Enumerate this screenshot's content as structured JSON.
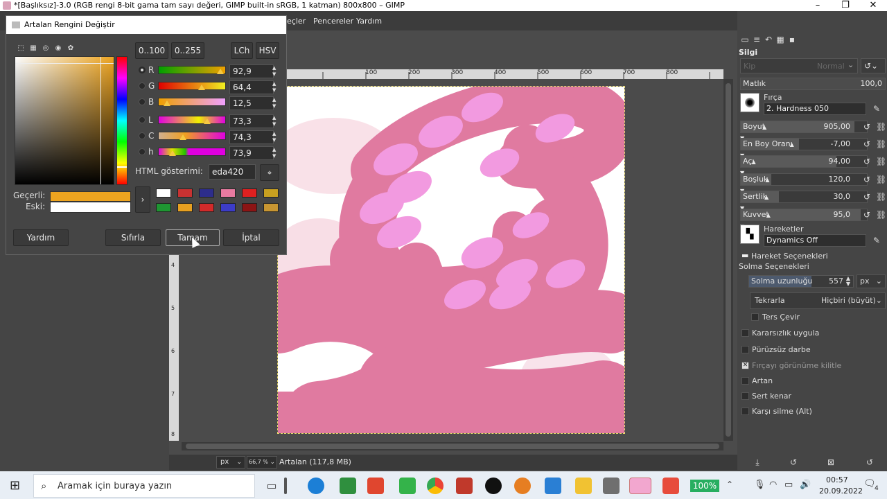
{
  "window": {
    "title": "*[Başlıksız]-3.0 (RGB rengi 8-bit gama tam sayı değeri, GIMP built-in sRGB, 1 katman) 800x800 – GIMP",
    "minimize": "–",
    "maximize": "❐",
    "close": "✕"
  },
  "menu": {
    "items": [
      "eçler",
      "Pencereler",
      "Yardım"
    ]
  },
  "dialog": {
    "title": "Artalan Rengini Değiştir",
    "range_buttons": [
      "0..100",
      "0..255"
    ],
    "model_buttons": [
      "LCh",
      "HSV"
    ],
    "sliders": [
      {
        "label": "R",
        "value": "92,9",
        "fraction": 0.929
      },
      {
        "label": "G",
        "value": "64,4",
        "fraction": 0.644
      },
      {
        "label": "B",
        "value": "12,5",
        "fraction": 0.125
      },
      {
        "label": "L",
        "value": "73,3",
        "fraction": 0.733
      },
      {
        "label": "C",
        "value": "74,3",
        "fraction": 0.36
      },
      {
        "label": "h",
        "value": "73,9",
        "fraction": 0.205
      }
    ],
    "html_label": "HTML gösterimi:",
    "html_value": "eda420",
    "current_label": "Geçerli:",
    "old_label": "Eski:",
    "current_color": "#eda420",
    "old_color": "#ffffff",
    "swatches": [
      "#ffffff",
      "#c83232",
      "#2d2d8c",
      "#e87aa0",
      "#e02020",
      "#c8a020",
      "#1e9632",
      "#e8a020",
      "#d22a2a",
      "#3c3cc8",
      "#8c1414",
      "#c89632"
    ],
    "buttons": {
      "help": "Yardım",
      "reset": "Sıfırla",
      "ok": "Tamam",
      "cancel": "İptal"
    }
  },
  "tool_options": {
    "tool_name": "Silgi",
    "mode_placeholder": "Kip",
    "mode_value": "Normal",
    "opacity_label": "Matlık",
    "opacity_value": "100,0",
    "brush_label": "Fırça",
    "brush_value": "2. Hardness 050",
    "rows": [
      {
        "label": "Boyut",
        "value": "905,00",
        "fraction": 0.9
      },
      {
        "label": "En Boy Oranı",
        "value": "-7,00",
        "fraction": 0.46
      },
      {
        "label": "Açı",
        "value": "94,00",
        "fraction": 0.76
      },
      {
        "label": "Boşluk",
        "value": "120,0",
        "fraction": 0.24
      },
      {
        "label": "Sertlik",
        "value": "30,0",
        "fraction": 0.3
      },
      {
        "label": "Kuvvet",
        "value": "95,0",
        "fraction": 0.95
      }
    ],
    "dynamics_label": "Hareketler",
    "dynamics_value": "Dynamics Off",
    "dynamics_options": "Hareket Seçenekleri",
    "fade_options": "Solma Seçenekleri",
    "fade_length_label": "Solma uzunluğu",
    "fade_length_value": "557",
    "fade_unit": "px",
    "repeat_label": "Tekrarla",
    "repeat_value": "Hiçbiri (büyüt)",
    "reverse": "Ters Çevir",
    "checkboxes": [
      {
        "label": "Kararsızlık uygula",
        "checked": false
      },
      {
        "label": "Pürüzsüz darbe",
        "checked": false
      },
      {
        "label": "Fırçayı görünüme kilitle",
        "checked": true
      },
      {
        "label": "Artan",
        "checked": false
      },
      {
        "label": "Sert kenar",
        "checked": false
      },
      {
        "label": "Karşı silme (Alt)",
        "checked": false
      }
    ]
  },
  "ruler": {
    "h_ticks": [
      "100",
      "200",
      "300",
      "400",
      "500",
      "600",
      "700",
      "800"
    ],
    "v_ticks": [
      "4",
      "5",
      "6",
      "7",
      "8"
    ]
  },
  "status": {
    "unit": "px",
    "zoom": "66,7 %",
    "layer_info": "Artalan (117,8 MB)"
  },
  "taskbar": {
    "search_placeholder": "Aramak için buraya yazın",
    "battery": "100%",
    "time": "00:57",
    "date": "20.09.2022",
    "notifications": "4"
  },
  "colors": {
    "stroke_pink": "#e07aa0",
    "blob_pink": "#f29ae0"
  }
}
